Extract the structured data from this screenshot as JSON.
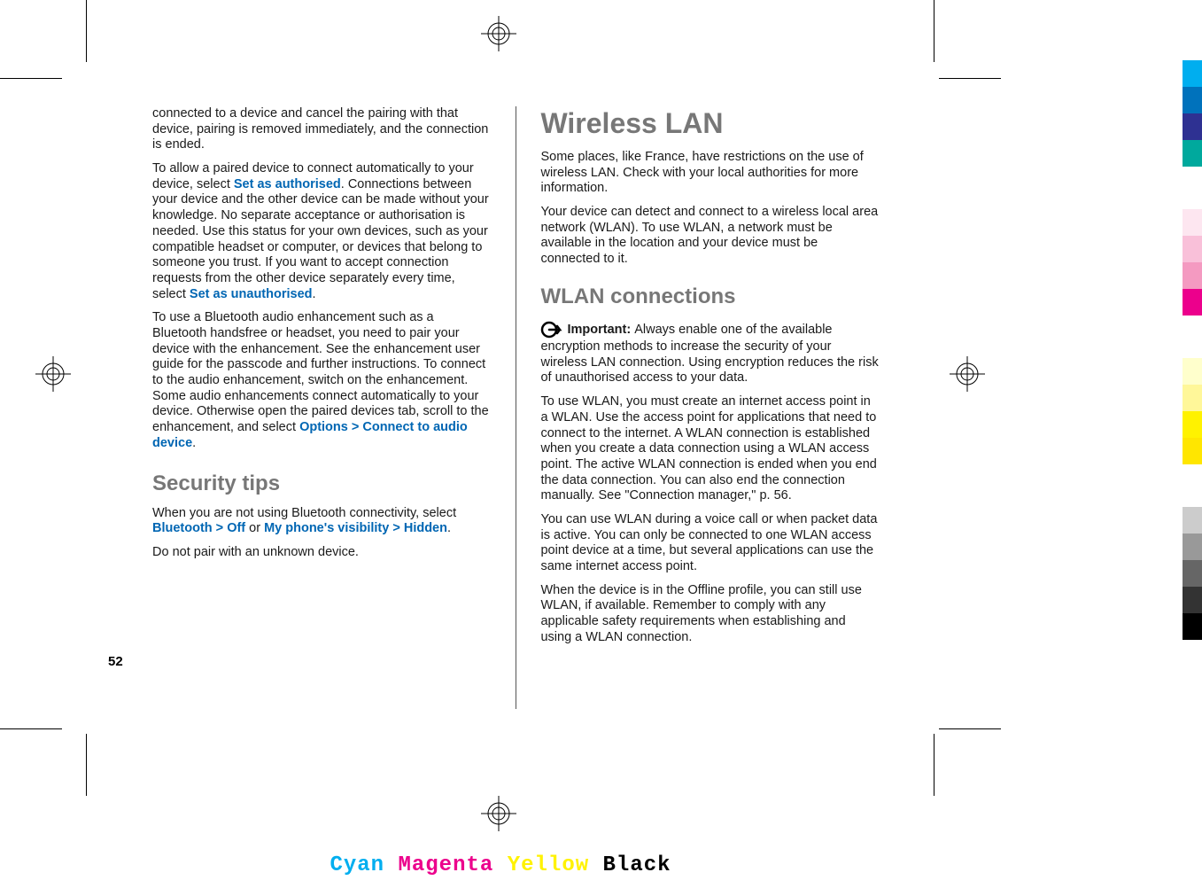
{
  "page_number": "52",
  "col1": {
    "p1": "connected to a device and cancel the pairing with that device, pairing is removed immediately, and the connection is ended.",
    "p2_pre": "To allow a paired device to connect automatically to your device, select ",
    "p2_link1": "Set as authorised",
    "p2_mid": ". Connections between your device and the other device can be made without your knowledge. No separate acceptance or authorisation is needed. Use this status for your own devices, such as your compatible headset or computer, or devices that belong to someone you trust. If you want to accept connection requests from the other device separately every time, select ",
    "p2_link2": "Set as unauthorised",
    "p2_post": ".",
    "p3_pre": "To use a Bluetooth audio enhancement such as a Bluetooth handsfree or headset, you need to pair your device with the enhancement. See the enhancement user guide for the passcode and further instructions. To connect to the audio enhancement, switch on the enhancement. Some audio enhancements connect automatically to your device. Otherwise open the paired devices tab, scroll to the enhancement, and select ",
    "p3_link1": "Options",
    "p3_gt": " > ",
    "p3_link2": "Connect to audio device",
    "p3_post": ".",
    "h_security": "Security tips",
    "p4_pre": "When you are not using Bluetooth connectivity, select ",
    "p4_link1": "Bluetooth",
    "p4_gt1": " > ",
    "p4_link2": "Off",
    "p4_or": " or ",
    "p4_link3": "My phone's visibility",
    "p4_gt2": " > ",
    "p4_link4": "Hidden",
    "p4_post": ".",
    "p5": "Do not pair with an unknown device."
  },
  "col2": {
    "h_wlan": "Wireless LAN",
    "p1": "Some places, like France, have restrictions on the use of wireless LAN. Check with your local authorities for more information.",
    "p2": "Your device can detect and connect to a wireless local area network (WLAN). To use WLAN, a network must be available in the location and your device must be connected to it.",
    "h_conn": "WLAN connections",
    "important_label": "Important: ",
    "important_text": "Always enable one of the available encryption methods to increase the security of your wireless LAN connection. Using encryption reduces the risk of unauthorised access to your data.",
    "p3": "To use WLAN, you must create an internet access point in a WLAN. Use the access point for applications that need to connect to the internet. A WLAN connection is established when you create a data connection using a WLAN access point. The active WLAN connection is ended when you end the data connection. You can also end the connection manually. See \"Connection manager,\" p. 56.",
    "p4": "You can use WLAN during a voice call or when packet data is active. You can only be connected to one WLAN access point device at a time, but several applications can use the same internet access point.",
    "p5": "When the device is in the Offline profile, you can still use WLAN, if available. Remember to comply with any applicable safety requirements when establishing and using a WLAN connection."
  },
  "footer": {
    "cyan": "Cyan",
    "magenta": "Magenta",
    "yellow": "Yellow",
    "black": "Black"
  },
  "color_bars": [
    "#00aeef",
    "#0072bc",
    "#2e3192",
    "#00a99d",
    "gap",
    "#fde6f0",
    "#f9c0d9",
    "#f49ac1",
    "#ec008c",
    "gap",
    "#ffffcc",
    "#fff799",
    "#fff200",
    "#ffe600",
    "gap",
    "#cccccc",
    "#999999",
    "#666666",
    "#333333",
    "#000000"
  ]
}
